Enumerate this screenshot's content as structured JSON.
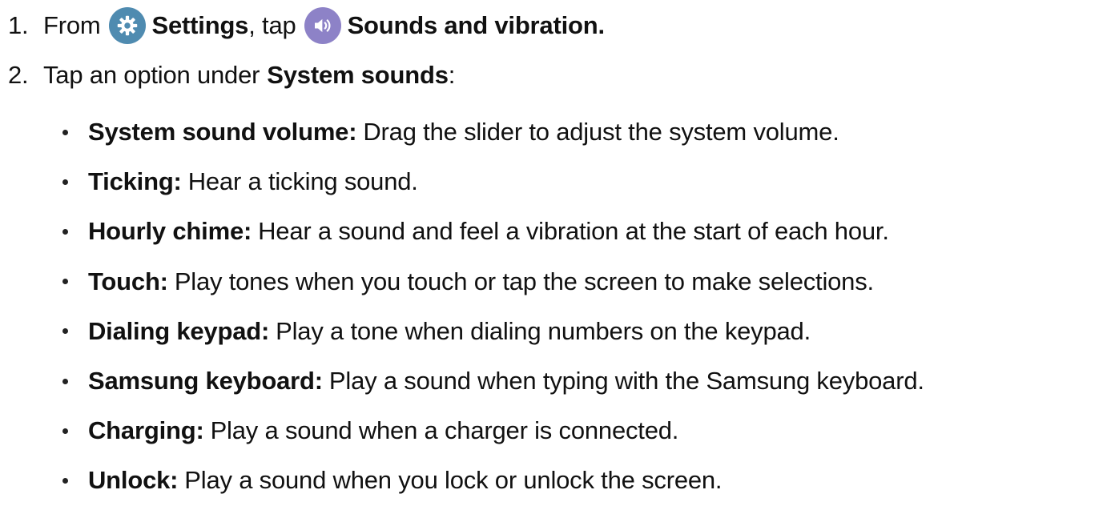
{
  "steps": [
    {
      "number": "1.",
      "text_before": "From",
      "icon1": "settings-gear-icon",
      "term1": "Settings",
      "text_middle": ", tap",
      "icon2": "sound-speaker-icon",
      "term2": "Sounds and vibration."
    },
    {
      "number": "2.",
      "text_before": "Tap an option under",
      "term": "System sounds",
      "text_after": ":"
    }
  ],
  "options": [
    {
      "term": "System sound volume:",
      "description": "Drag the slider to adjust the system volume."
    },
    {
      "term": "Ticking:",
      "description": "Hear a ticking sound."
    },
    {
      "term": "Hourly chime:",
      "description": "Hear a sound and feel a vibration at the start of each hour."
    },
    {
      "term": "Touch:",
      "description": "Play tones when you touch or tap the screen to make selections."
    },
    {
      "term": "Dialing keypad:",
      "description": "Play a tone when dialing numbers on the keypad."
    },
    {
      "term": "Samsung keyboard:",
      "description": "Play a sound when typing with the Samsung keyboard."
    },
    {
      "term": "Charging:",
      "description": "Play a sound when a charger is connected."
    },
    {
      "term": "Unlock:",
      "description": "Play a sound when you lock or unlock the screen."
    }
  ],
  "colors": {
    "settings_icon_bg": "#4f8bb0",
    "sounds_icon_bg": "#8d82c7",
    "text": "#111111"
  }
}
